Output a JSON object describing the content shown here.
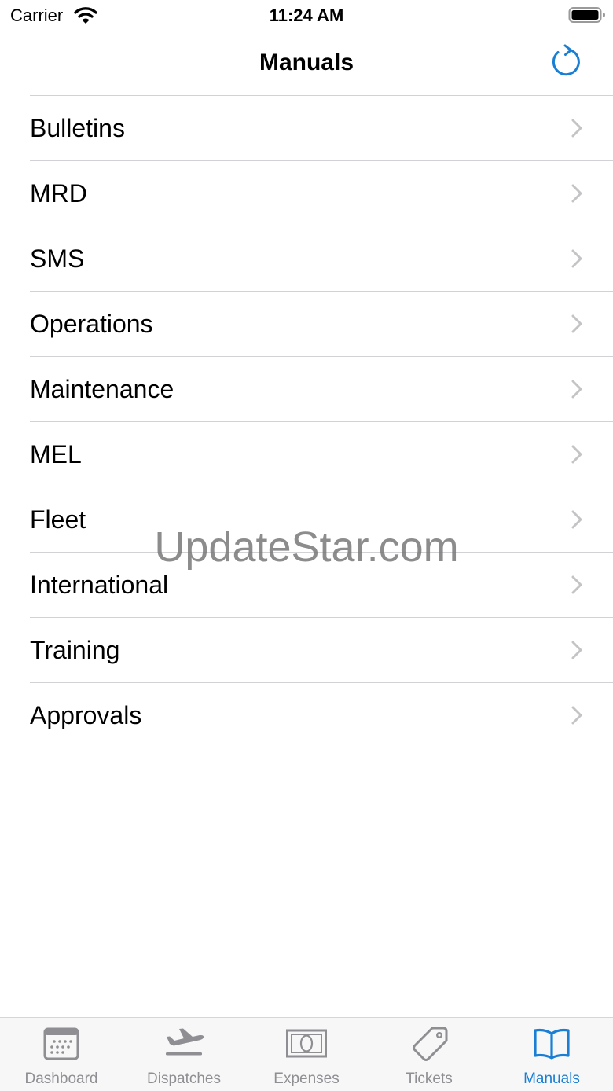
{
  "status_bar": {
    "carrier": "Carrier",
    "time": "11:24 AM"
  },
  "nav": {
    "title": "Manuals",
    "refresh_icon": "refresh-icon"
  },
  "colors": {
    "accent": "#1a7fd4",
    "separator": "#d1d1d6",
    "chevron": "#c4c4c7",
    "tab_inactive": "#8e8e93",
    "tab_bar_bg": "#f7f7f7"
  },
  "manuals": {
    "items": [
      {
        "label": "Bulletins"
      },
      {
        "label": "MRD"
      },
      {
        "label": "SMS"
      },
      {
        "label": "Operations"
      },
      {
        "label": "Maintenance"
      },
      {
        "label": "MEL"
      },
      {
        "label": "Fleet"
      },
      {
        "label": "International"
      },
      {
        "label": "Training"
      },
      {
        "label": "Approvals"
      }
    ]
  },
  "watermark": "UpdateStar.com",
  "tabs": [
    {
      "label": "Dashboard",
      "icon": "calendar-icon",
      "active": false
    },
    {
      "label": "Dispatches",
      "icon": "airplane-departure-icon",
      "active": false
    },
    {
      "label": "Expenses",
      "icon": "banknote-icon",
      "active": false
    },
    {
      "label": "Tickets",
      "icon": "tag-icon",
      "active": false
    },
    {
      "label": "Manuals",
      "icon": "book-icon",
      "active": true
    }
  ]
}
